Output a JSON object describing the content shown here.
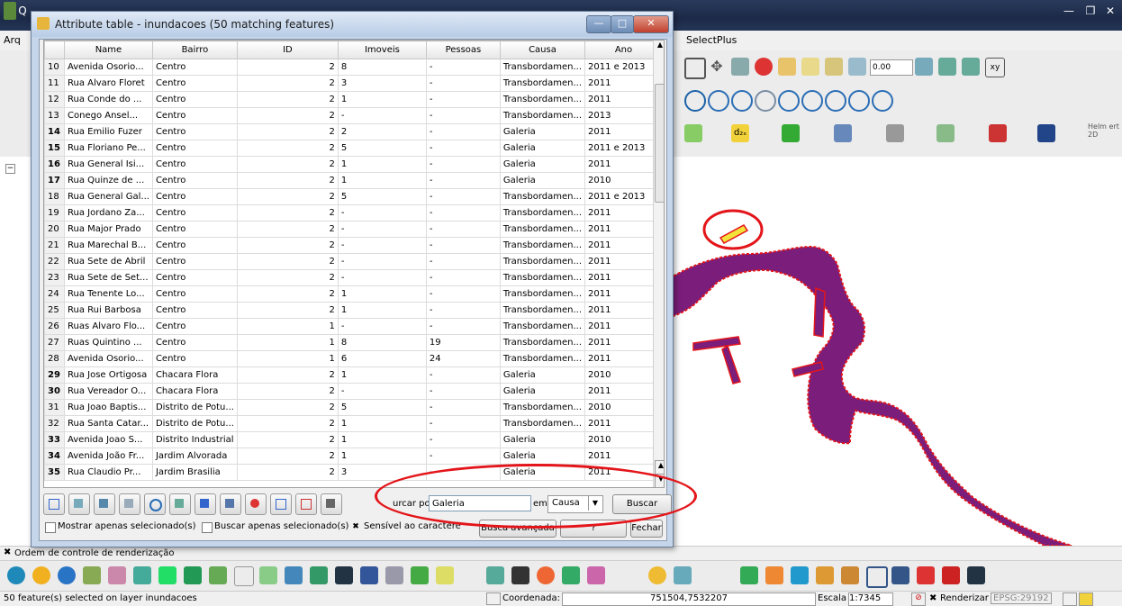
{
  "main_window": {
    "title_left": "Q",
    "menu_first": "Arq",
    "menu_plugin": "SelectPlus",
    "scale_input": "0.00",
    "help_label": "Helm ert 2D"
  },
  "layer_panel": {
    "collapse_icon": "minus-box-icon"
  },
  "render_order_label": "Ordem de controle de renderização",
  "status_bar": {
    "message": "50 feature(s) selected on layer inundacoes",
    "coord_label": "Coordenada:",
    "coord_value": "751504,7532207",
    "scale_label": "Escala",
    "scale_value": "1:7345",
    "render_label": "Renderizar",
    "crs": "EPSG:29192"
  },
  "attribute_dialog": {
    "title": "Attribute table - inundacoes (50 matching features)",
    "columns": [
      "Name",
      "Bairro",
      "ID",
      "Imoveis",
      "Pessoas",
      "Causa",
      "Ano"
    ],
    "rows": [
      {
        "n": "10",
        "sel": false,
        "name": "Avenida Osorio...",
        "bairro": "Centro",
        "id": "2",
        "imoveis": "8",
        "pessoas": "-",
        "causa": "Transbordamen...",
        "ano": "2011 e 2013"
      },
      {
        "n": "11",
        "sel": false,
        "name": "Rua Alvaro Floret",
        "bairro": "Centro",
        "id": "2",
        "imoveis": "3",
        "pessoas": "-",
        "causa": "Transbordamen...",
        "ano": "2011"
      },
      {
        "n": "12",
        "sel": false,
        "name": "Rua Conde do ...",
        "bairro": "Centro",
        "id": "2",
        "imoveis": "1",
        "pessoas": "-",
        "causa": "Transbordamen...",
        "ano": "2011"
      },
      {
        "n": "13",
        "sel": false,
        "name": "Conego Ansel...",
        "bairro": "Centro",
        "id": "2",
        "imoveis": "-",
        "pessoas": "-",
        "causa": "Transbordamen...",
        "ano": "2013"
      },
      {
        "n": "14",
        "sel": true,
        "name": "Rua Emilio Fuzer",
        "bairro": "Centro",
        "id": "2",
        "imoveis": "2",
        "pessoas": "-",
        "causa": "Galeria",
        "ano": "2011"
      },
      {
        "n": "15",
        "sel": true,
        "name": "Rua Floriano Pe...",
        "bairro": "Centro",
        "id": "2",
        "imoveis": "5",
        "pessoas": "-",
        "causa": "Galeria",
        "ano": "2011 e 2013"
      },
      {
        "n": "16",
        "sel": true,
        "name": "Rua General Isi...",
        "bairro": "Centro",
        "id": "2",
        "imoveis": "1",
        "pessoas": "-",
        "causa": "Galeria",
        "ano": "2011"
      },
      {
        "n": "17",
        "sel": true,
        "name": "Rua Quinze de ...",
        "bairro": "Centro",
        "id": "2",
        "imoveis": "1",
        "pessoas": "-",
        "causa": "Galeria",
        "ano": "2010"
      },
      {
        "n": "18",
        "sel": false,
        "name": "Rua General Gal...",
        "bairro": "Centro",
        "id": "2",
        "imoveis": "5",
        "pessoas": "-",
        "causa": "Transbordamen...",
        "ano": "2011 e 2013"
      },
      {
        "n": "19",
        "sel": false,
        "name": "Rua Jordano Za...",
        "bairro": "Centro",
        "id": "2",
        "imoveis": "-",
        "pessoas": "-",
        "causa": "Transbordamen...",
        "ano": "2011"
      },
      {
        "n": "20",
        "sel": false,
        "name": "Rua Major Prado",
        "bairro": "Centro",
        "id": "2",
        "imoveis": "-",
        "pessoas": "-",
        "causa": "Transbordamen...",
        "ano": "2011"
      },
      {
        "n": "21",
        "sel": false,
        "name": "Rua Marechal B...",
        "bairro": "Centro",
        "id": "2",
        "imoveis": "-",
        "pessoas": "-",
        "causa": "Transbordamen...",
        "ano": "2011"
      },
      {
        "n": "22",
        "sel": false,
        "name": "Rua Sete de Abril",
        "bairro": "Centro",
        "id": "2",
        "imoveis": "-",
        "pessoas": "-",
        "causa": "Transbordamen...",
        "ano": "2011"
      },
      {
        "n": "23",
        "sel": false,
        "name": "Rua Sete de Set...",
        "bairro": "Centro",
        "id": "2",
        "imoveis": "-",
        "pessoas": "-",
        "causa": "Transbordamen...",
        "ano": "2011"
      },
      {
        "n": "24",
        "sel": false,
        "name": "Rua Tenente Lo...",
        "bairro": "Centro",
        "id": "2",
        "imoveis": "1",
        "pessoas": "-",
        "causa": "Transbordamen...",
        "ano": "2011"
      },
      {
        "n": "25",
        "sel": false,
        "name": "Rua Rui Barbosa",
        "bairro": "Centro",
        "id": "2",
        "imoveis": "1",
        "pessoas": "-",
        "causa": "Transbordamen...",
        "ano": "2011"
      },
      {
        "n": "26",
        "sel": false,
        "name": "Ruas Alvaro Flo...",
        "bairro": "Centro",
        "id": "1",
        "imoveis": "-",
        "pessoas": "-",
        "causa": "Transbordamen...",
        "ano": "2011"
      },
      {
        "n": "27",
        "sel": false,
        "name": "Ruas Quintino ...",
        "bairro": "Centro",
        "id": "1",
        "imoveis": "8",
        "pessoas": "19",
        "causa": "Transbordamen...",
        "ano": "2011"
      },
      {
        "n": "28",
        "sel": false,
        "name": "Avenida Osorio...",
        "bairro": "Centro",
        "id": "1",
        "imoveis": "6",
        "pessoas": "24",
        "causa": "Transbordamen...",
        "ano": "2011"
      },
      {
        "n": "29",
        "sel": true,
        "name": "Rua Jose Ortigosa",
        "bairro": "Chacara Flora",
        "id": "2",
        "imoveis": "1",
        "pessoas": "-",
        "causa": "Galeria",
        "ano": "2010"
      },
      {
        "n": "30",
        "sel": true,
        "name": "Rua Vereador O...",
        "bairro": "Chacara Flora",
        "id": "2",
        "imoveis": "-",
        "pessoas": "-",
        "causa": "Galeria",
        "ano": "2011"
      },
      {
        "n": "31",
        "sel": false,
        "name": "Rua Joao Baptis...",
        "bairro": "Distrito de Potu...",
        "id": "2",
        "imoveis": "5",
        "pessoas": "-",
        "causa": "Transbordamen...",
        "ano": "2010"
      },
      {
        "n": "32",
        "sel": false,
        "name": "Rua Santa Catar...",
        "bairro": "Distrito de Potu...",
        "id": "2",
        "imoveis": "1",
        "pessoas": "-",
        "causa": "Transbordamen...",
        "ano": "2011"
      },
      {
        "n": "33",
        "sel": true,
        "name": "Avenida Joao S...",
        "bairro": "Distrito Industrial",
        "id": "2",
        "imoveis": "1",
        "pessoas": "-",
        "causa": "Galeria",
        "ano": "2010"
      },
      {
        "n": "34",
        "sel": true,
        "name": "Avenida João Fr...",
        "bairro": "Jardim Alvorada",
        "id": "2",
        "imoveis": "1",
        "pessoas": "-",
        "causa": "Galeria",
        "ano": "2011"
      },
      {
        "n": "35",
        "sel": true,
        "name": "Rua Claudio Pr...",
        "bairro": "Jardim Brasilia",
        "id": "2",
        "imoveis": "3",
        "pessoas": "-",
        "causa": "Galeria",
        "ano": "2011"
      }
    ],
    "search": {
      "label": "urcar por",
      "value": "Galeria",
      "em_label": "em",
      "field": "Causa",
      "button": "Buscar"
    },
    "options": {
      "only_selected_show": "Mostrar apenas selecionado(s)",
      "only_selected_search": "Buscar apenas selecionado(s)",
      "case_sensitive": "Sensível ao caractere",
      "case_sensitive_checked": "✖",
      "advanced": "Busca avançada",
      "help": "?",
      "close": "Fechar"
    }
  },
  "colors": {
    "polygon_fill": "#7b1d7a",
    "polygon_stroke": "#e3151a",
    "highlight": "#e3151a",
    "selection_yellow": "#f2e23a"
  }
}
